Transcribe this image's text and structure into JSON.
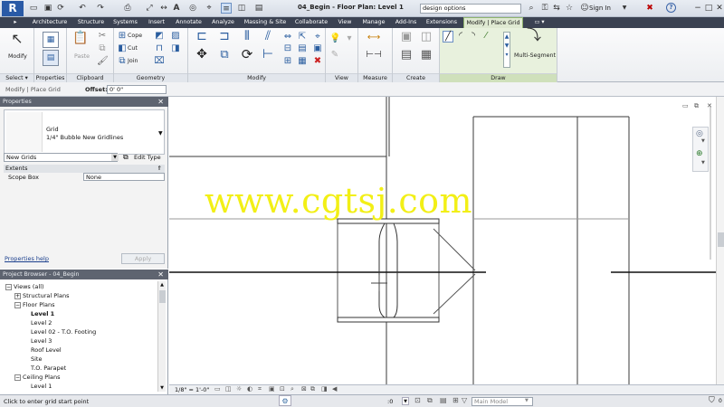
{
  "titlebar": {
    "app_logo": "R",
    "document_title": "04_Begin - Floor Plan: Level 1",
    "search_value": "design options",
    "sign_in_label": "Sign In",
    "help_label": "?"
  },
  "tabs": [
    "Architecture",
    "Structure",
    "Systems",
    "Insert",
    "Annotate",
    "Analyze",
    "Massing & Site",
    "Collaborate",
    "View",
    "Manage",
    "Add-Ins",
    "Extensions",
    "Modify | Place Grid"
  ],
  "ribbon": {
    "select_panel": {
      "modify_label": "Modify",
      "footer_label": "Select ▾"
    },
    "properties_panel": {
      "footer_label": "Properties"
    },
    "clipboard_panel": {
      "paste_label": "Paste",
      "footer_label": "Clipboard"
    },
    "geometry_panel": {
      "cope_label": "Cope",
      "cut_label": "Cut",
      "join_label": "Join",
      "footer_label": "Geometry"
    },
    "modify_panel": {
      "footer_label": "Modify"
    },
    "view_panel": {
      "footer_label": "View"
    },
    "measure_panel": {
      "footer_label": "Measure"
    },
    "create_panel": {
      "footer_label": "Create"
    },
    "draw_panel": {
      "multi_segment_label": "Multi-Segment",
      "footer_label": "Draw"
    }
  },
  "options_bar": {
    "context_label": "Modify | Place Grid",
    "offset_label": "Offset:",
    "offset_value": "0' 0\""
  },
  "properties": {
    "title": "Properties",
    "type_name": "Grid",
    "type_subname": "1/4\" Bubble New Gridlines",
    "instance_selector": "New Grids",
    "edit_type_label": "Edit Type",
    "group_label": "Extents",
    "rows": [
      {
        "name": "Scope Box",
        "value": "None"
      }
    ],
    "help_link": "Properties help",
    "apply_label": "Apply"
  },
  "project_browser": {
    "title": "Project Browser - 04_Begin",
    "items": [
      {
        "label": "Views (all)",
        "indent": 0,
        "toggle": "−",
        "bold": false
      },
      {
        "label": "Structural Plans",
        "indent": 1,
        "toggle": "+",
        "bold": false
      },
      {
        "label": "Floor Plans",
        "indent": 1,
        "toggle": "−",
        "bold": false
      },
      {
        "label": "Level 1",
        "indent": 2,
        "toggle": "",
        "bold": true
      },
      {
        "label": "Level 2",
        "indent": 2,
        "toggle": "",
        "bold": false
      },
      {
        "label": "Level 02 - T.O. Footing",
        "indent": 2,
        "toggle": "",
        "bold": false
      },
      {
        "label": "Level 3",
        "indent": 2,
        "toggle": "",
        "bold": false
      },
      {
        "label": "Roof Level",
        "indent": 2,
        "toggle": "",
        "bold": false
      },
      {
        "label": "Site",
        "indent": 2,
        "toggle": "",
        "bold": false
      },
      {
        "label": "T.O. Parapet",
        "indent": 2,
        "toggle": "",
        "bold": false
      },
      {
        "label": "Ceiling Plans",
        "indent": 1,
        "toggle": "−",
        "bold": false
      },
      {
        "label": "Level 1",
        "indent": 2,
        "toggle": "",
        "bold": false
      }
    ]
  },
  "view_control_bar": {
    "scale": "1/8\" = 1'-0\""
  },
  "status_bar": {
    "prompt": "Click to enter grid start point",
    "zero_value": ":0",
    "model_label": "Main Model"
  },
  "watermark": "www.cgtsj.com",
  "colors": {
    "tab_bar": "#3b4252",
    "active_tab": "#dfe9d2",
    "watermark": "#f2ef16",
    "pane_title": "#5e6470"
  }
}
